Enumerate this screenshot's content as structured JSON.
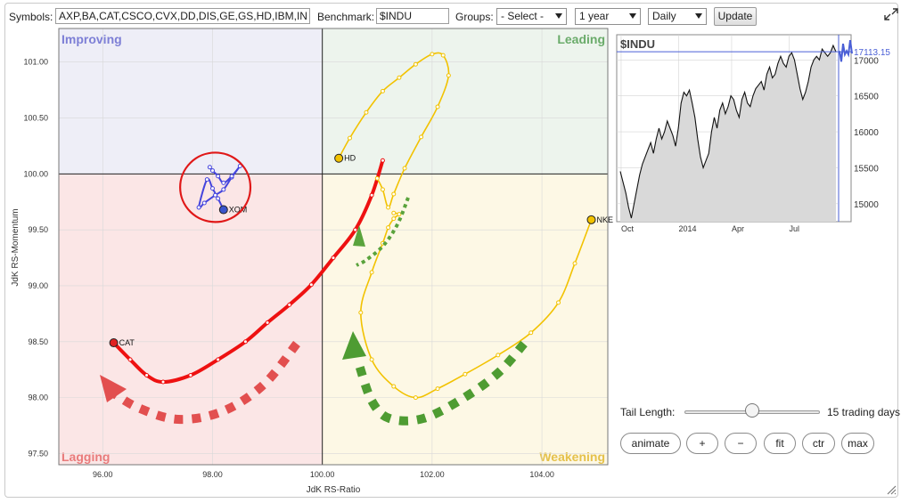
{
  "toolbar": {
    "symbols_label": "Symbols:",
    "symbols_value": "AXP,BA,CAT,CSCO,CVX,DD,DIS,GE,GS,HD,IBM,IN",
    "benchmark_label": "Benchmark:",
    "benchmark_value": "$INDU",
    "groups_label": "Groups:",
    "groups_value": "- Select -",
    "period_value": "1 year",
    "frequency_value": "Daily",
    "update_label": "Update",
    "expand_icon": "expand-icon"
  },
  "chart_data": [
    {
      "type": "scatter",
      "title": "",
      "xlabel": "JdK RS-Ratio",
      "ylabel": "JdK RS-Momentum",
      "xlim": [
        95.2,
        105.2
      ],
      "ylim": [
        97.4,
        101.3
      ],
      "x_ticks": [
        96,
        98,
        100,
        102,
        104
      ],
      "x_tick_labels": [
        "96.00",
        "98.00",
        "100.00",
        "102.00",
        "104.00"
      ],
      "y_ticks": [
        97.5,
        98.0,
        98.5,
        99.0,
        99.5,
        100.0,
        100.5,
        101.0
      ],
      "y_tick_labels": [
        "97.50",
        "98.00",
        "98.50",
        "99.00",
        "99.50",
        "100.00",
        "100.50",
        "101.00"
      ],
      "center": [
        100,
        100
      ],
      "grid": true,
      "quadrants": [
        {
          "name": "Improving",
          "color": "#7d7fd6",
          "fill": "#eeeef7",
          "corner": "top-left"
        },
        {
          "name": "Leading",
          "color": "#6aab6a",
          "fill": "#edf4ed",
          "corner": "top-right"
        },
        {
          "name": "Lagging",
          "color": "#e97b7b",
          "fill": "#fbe6e6",
          "corner": "bottom-left"
        },
        {
          "name": "Weakening",
          "color": "#e5c14a",
          "fill": "#fdf8e5",
          "corner": "bottom-right"
        }
      ],
      "series": [
        {
          "name": "CAT",
          "color": "#ee1111",
          "head_color": "#e02020",
          "width": 4,
          "x": [
            96.2,
            96.5,
            96.8,
            97.1,
            97.6,
            98.1,
            98.6,
            99.0,
            99.4,
            99.8,
            100.2,
            100.6,
            100.9,
            101.1
          ],
          "y": [
            98.49,
            98.34,
            98.2,
            98.14,
            98.2,
            98.34,
            98.5,
            98.67,
            98.83,
            99.01,
            99.25,
            99.5,
            99.81,
            100.12
          ]
        },
        {
          "name": "XOM",
          "color": "#4444dd",
          "head_color": "#3a55cc",
          "width": 2,
          "x": [
            98.2,
            98.1,
            98.0,
            97.9,
            97.75,
            97.85,
            98.05,
            98.2,
            98.35,
            98.5,
            98.35,
            98.2,
            98.1,
            98.0,
            97.95
          ],
          "y": [
            99.68,
            99.78,
            99.87,
            99.95,
            99.7,
            99.74,
            99.81,
            99.86,
            99.97,
            100.07,
            99.98,
            99.92,
            99.98,
            100.03,
            100.06
          ]
        },
        {
          "name": "HD",
          "color": "#f2c200",
          "head_color": "#f2c200",
          "width": 1.6,
          "x": [
            100.3,
            100.5,
            100.8,
            101.1,
            101.4,
            101.7,
            102.0,
            102.2,
            102.3,
            102.1,
            101.8,
            101.5,
            101.3,
            101.2,
            101.1,
            101.0
          ],
          "y": [
            100.14,
            100.32,
            100.55,
            100.74,
            100.86,
            100.98,
            101.07,
            101.06,
            100.88,
            100.6,
            100.33,
            100.05,
            99.82,
            99.7,
            99.86,
            99.96
          ]
        },
        {
          "name": "NKE",
          "color": "#f2c200",
          "head_color": "#f2c200",
          "width": 1.6,
          "x": [
            104.9,
            104.6,
            104.3,
            103.8,
            103.2,
            102.6,
            102.1,
            101.7,
            101.3,
            100.9,
            100.7,
            100.9,
            101.1,
            101.2,
            101.3,
            101.4,
            101.3
          ],
          "y": [
            99.59,
            99.2,
            98.85,
            98.58,
            98.38,
            98.21,
            98.08,
            98.0,
            98.1,
            98.34,
            98.76,
            99.12,
            99.38,
            99.52,
            99.6,
            99.64,
            99.65
          ]
        }
      ],
      "annotations": [
        {
          "label": "red-circle-highlight",
          "shape": "ellipse",
          "center": [
            98.05,
            99.88
          ],
          "radius_x": 0.64,
          "radius_y": 0.31,
          "color": "#e01818"
        },
        {
          "label": "lagging-dashed-arrow",
          "color": "#e24f4f",
          "direction": "left"
        },
        {
          "label": "weakening-dashed-arrow",
          "color": "#4e9c32",
          "direction": "up"
        },
        {
          "label": "short-green-dotted-arrow",
          "color": "#5aa33c",
          "direction": "up"
        }
      ]
    },
    {
      "type": "line",
      "title": "$INDU",
      "current_value_label": "17113.15",
      "x_tick_labels": [
        "Oct",
        "2014",
        "Apr",
        "Jul"
      ],
      "y_ticks": [
        15000,
        15500,
        16000,
        16500,
        17000
      ],
      "y_tick_labels": [
        "15000",
        "15500",
        "16000",
        "16500",
        "17000"
      ],
      "ylim": [
        14750,
        17350
      ],
      "series": [
        {
          "name": "$INDU",
          "color": "#111111",
          "values": [
            15450,
            15300,
            15150,
            14950,
            14800,
            15000,
            15200,
            15400,
            15550,
            15650,
            15750,
            15850,
            15700,
            15900,
            16050,
            15900,
            16000,
            16150,
            16050,
            15950,
            15800,
            16050,
            16400,
            16550,
            16500,
            16580,
            16400,
            16200,
            15900,
            15650,
            15500,
            15600,
            15700,
            16000,
            16200,
            16050,
            16300,
            16400,
            16250,
            16350,
            16500,
            16450,
            16300,
            16200,
            16450,
            16550,
            16400,
            16350,
            16500,
            16600,
            16650,
            16700,
            16580,
            16800,
            16900,
            16750,
            16800,
            16950,
            17050,
            16950,
            16900,
            17050,
            17100,
            17000,
            16800,
            16600,
            16450,
            16550,
            16700,
            16900,
            17000,
            17050,
            17000,
            17150,
            17100,
            17050,
            17100,
            17200,
            17113
          ]
        }
      ]
    }
  ],
  "controls": {
    "tail_length_label": "Tail Length:",
    "tail_length_value": 15,
    "tail_length_max": 30,
    "tail_length_text": "15 trading days",
    "buttons": [
      "animate",
      "+",
      "−",
      "fit",
      "ctr",
      "max"
    ]
  },
  "colors": {
    "accent_red": "#ee1111",
    "accent_blue": "#4444dd",
    "accent_yellow": "#f2c200",
    "accent_green": "#4e9c32",
    "benchmark_line": "#4a5fd6"
  }
}
